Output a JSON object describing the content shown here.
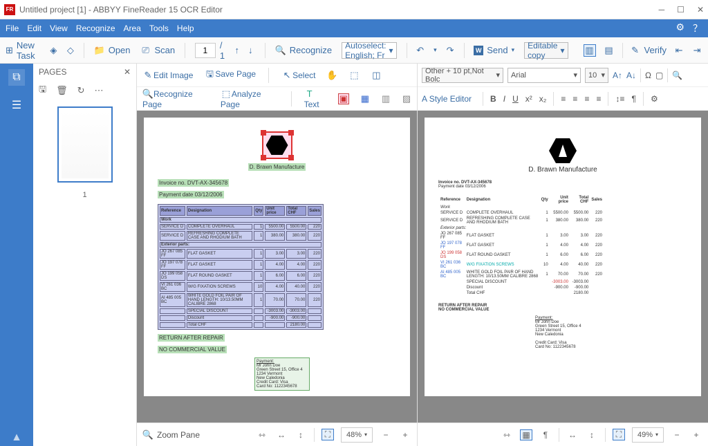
{
  "window": {
    "title": "Untitled project [1] - ABBYY FineReader 15 OCR Editor"
  },
  "menu": {
    "file": "File",
    "edit": "Edit",
    "view": "View",
    "recognize": "Recognize",
    "area": "Area",
    "tools": "Tools",
    "help": "Help"
  },
  "tb1": {
    "new_task": "New Task",
    "open": "Open",
    "scan": "Scan",
    "page_current": "1",
    "page_total": "/ 1",
    "recognize_btn": "Recognize",
    "lang": "Autoselect: English; Fr",
    "send": "Send",
    "editable": "Editable copy",
    "verify": "Verify"
  },
  "pages": {
    "title": "PAGES",
    "thumb_num": "1"
  },
  "imgtools": {
    "edit_image": "Edit Image",
    "save_page": "Save Page",
    "recognize_page": "Recognize Page",
    "analyze_page": "Analyze Page",
    "select": "Select",
    "text": "Text"
  },
  "zoom_left": {
    "label": "Zoom Pane",
    "value": "48%"
  },
  "zoom_right": {
    "value": "49%"
  },
  "rp": {
    "style_box": "Other + 10 pt,Not Bolc",
    "font": "Arial",
    "size": "10",
    "style_editor": "Style Editor"
  },
  "doc": {
    "company": "D. Brawn Manufacture",
    "invoice": "Invoice no. DVT-AX-345678",
    "paydate": "Payment date 03/12/2006",
    "hdr": {
      "ref": "Reference",
      "des": "Designation",
      "qty": "Qty",
      "price": "Unit price",
      "total": "Total CHF",
      "sales": "Sales"
    },
    "sec_work": "Work",
    "rows_work": [
      {
        "ref": "SERVICE D",
        "des": "COMPLETE OVERHAUL",
        "qty": "1",
        "price": "5500.00",
        "total": "5500.00",
        "sales": "220"
      },
      {
        "ref": "SERVICE D",
        "des": "REFRESHING COMPLETE CASE AND RHODIUM BATH",
        "qty": "1",
        "price": "380.00",
        "total": "380.00",
        "sales": "220"
      }
    ],
    "sec_ext": "Exterior parts:",
    "rows_ext": [
      {
        "ref": "JO 267 085 FF",
        "des": "FLAT GASKET",
        "qty": "1",
        "price": "3.00",
        "total": "3.00",
        "sales": "220"
      },
      {
        "ref": "JO 197 078 FF",
        "des": "FLAT GASKET",
        "qty": "1",
        "price": "4.00",
        "total": "4.00",
        "sales": "220"
      },
      {
        "ref": "JO 199 058 DS",
        "des": "FLAT ROUND GASKET",
        "qty": "1",
        "price": "6.00",
        "total": "6.00",
        "sales": "220"
      },
      {
        "ref": "VI 261 036 BC",
        "des": "W/G FIXATION SCREWS",
        "qty": "10",
        "price": "4.00",
        "total": "40.00",
        "sales": "220"
      },
      {
        "ref": "AI 485 005 BC",
        "des": "WHITE GOLD FOIL PAIR OF HAND LENGTH: 10/13.50MM CALIBRE 2868",
        "qty": "1",
        "price": "70.00",
        "total": "70.00",
        "sales": "220"
      }
    ],
    "discount_label": "SPECIAL DISCOUNT",
    "discount_val": "-3003.00",
    "discount_total": "-3003.00",
    "disc2_label": "Discount",
    "disc2_val": "-900.00",
    "disc2_total": "-900.00",
    "total_label": "Total CHF",
    "total_val": "2180.00",
    "return": "RETURN AFTER REPAIR",
    "nocom": "NO COMMERCIAL VALUE",
    "pay_title": "Payment:",
    "pay_l1": "Mr John Doe",
    "pay_l2": "Green Street 15, Office 4",
    "pay_l3": "1234 Vermont",
    "pay_l4": "New Caledonia",
    "pay_l5": "Credit Card: Visa",
    "pay_l6": "Card No: 1122345678"
  }
}
